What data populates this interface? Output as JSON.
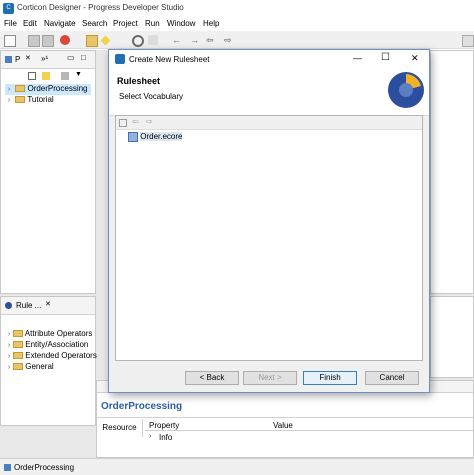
{
  "window": {
    "title": "Corticon Designer - Progress Developer Studio",
    "app_icon": "corticon-app-icon"
  },
  "menu": [
    "File",
    "Edit",
    "Navigate",
    "Search",
    "Project",
    "Run",
    "Window",
    "Help"
  ],
  "project_explorer": {
    "tab_label": "P",
    "tab2_label": "»¹",
    "items": [
      {
        "label": "OrderProcessing",
        "selected": true
      },
      {
        "label": "Tutorial",
        "selected": false
      }
    ]
  },
  "rule_panel": {
    "tab_label": "Rule ...",
    "items": [
      "Attribute Operators",
      "Entity/Association",
      "Extended Operators",
      "General"
    ]
  },
  "properties": {
    "title": "OrderProcessing",
    "tab_resource": "Resource",
    "col_property": "Property",
    "col_value": "Value",
    "row_info": "Info"
  },
  "dialog": {
    "title": "Create New Rulesheet",
    "heading": "Rulesheet",
    "subheading": "Select Vocabulary",
    "tree_item": "Order.ecore",
    "buttons": {
      "back": "< Back",
      "next": "Next >",
      "finish": "Finish",
      "cancel": "Cancel"
    },
    "window_controls": {
      "minimize": "—",
      "maximize": "☐",
      "close": "✕"
    }
  },
  "status": {
    "text": "OrderProcessing"
  },
  "colors": {
    "accent": "#0078d7",
    "selection": "#cce8ff",
    "dialog_border": "#6b8fc7",
    "logo_blue": "#2b4f9e",
    "logo_gold": "#f0b323"
  }
}
